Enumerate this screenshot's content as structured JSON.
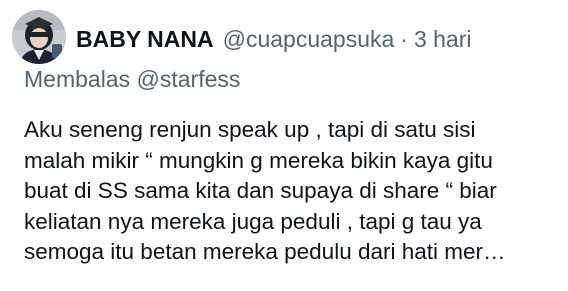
{
  "author": {
    "display_name": "BABY NANA",
    "handle": "@cuapcuapsuka",
    "separator": "·",
    "time": "3 hari",
    "avatar": "profile-avatar"
  },
  "reply": {
    "prefix": "Membalas",
    "target": "@starfess"
  },
  "tweet": {
    "lines": [
      "Aku seneng renjun speak up , tapi di satu sisi",
      "malah mikir “ mungkin g mereka bikin kaya gitu",
      "buat di SS sama kita dan supaya di share “ biar",
      "keliatan nya mereka juga peduli , tapi g tau ya",
      "semoga itu betan mereka pedulu dari hati mer…"
    ]
  }
}
